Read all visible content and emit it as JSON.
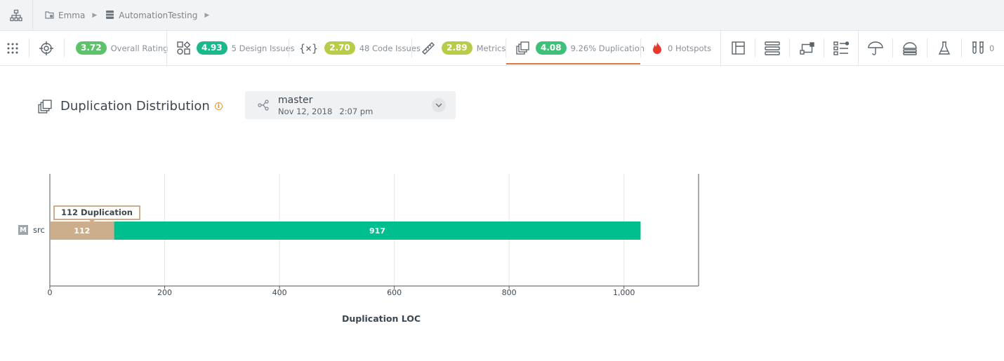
{
  "breadcrumb": {
    "project": "Emma",
    "repo": "AutomationTesting"
  },
  "tabs": {
    "overall": {
      "score": "3.72",
      "label": "Overall Rating",
      "color": "#5ec26a"
    },
    "design": {
      "score": "4.93",
      "label": "5 Design Issues",
      "color": "#1bb98a"
    },
    "code": {
      "score": "2.70",
      "label": "48 Code Issues",
      "color": "#b9cc4a"
    },
    "metrics": {
      "score": "2.89",
      "label": "Metrics",
      "color": "#b9cc4a"
    },
    "duplication": {
      "score": "4.08",
      "label": "9.26% Duplication",
      "color": "#3fc07a"
    },
    "hotspots": {
      "label": "0 Hotspots"
    },
    "tests_count": "0"
  },
  "page": {
    "title": "Duplication Distribution",
    "branch_name": "master",
    "branch_date": "Nov 12, 2018",
    "branch_time": "2:07 pm"
  },
  "chart_data": {
    "type": "bar",
    "orientation": "horizontal",
    "stacked": true,
    "categories": [
      "src"
    ],
    "category_badges": [
      "M"
    ],
    "series": [
      {
        "values": [
          112
        ],
        "color": "#cdae8c"
      },
      {
        "values": [
          917
        ],
        "color": "#00bf8f"
      }
    ],
    "xlabel": "Duplication LOC",
    "xlim": [
      0,
      1130
    ],
    "xticks": [
      0,
      200,
      400,
      600,
      800,
      1000
    ],
    "xtick_labels": [
      "0",
      "200",
      "400",
      "600",
      "800",
      "1,000"
    ],
    "tooltip": "112 Duplication",
    "grid": true
  }
}
